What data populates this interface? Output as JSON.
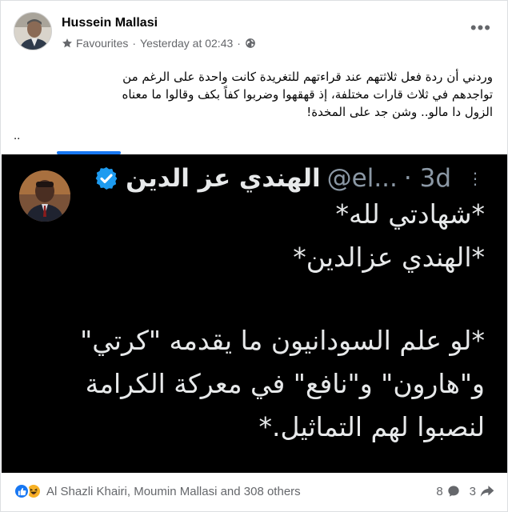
{
  "post": {
    "author": "Hussein Mallasi",
    "audience": "Favourites",
    "separator": "·",
    "timestamp": "Yesterday at 02:43",
    "text_lines": [
      "وردني أن ردة فعل ثلاثتهم عند قراءتهم للتغريدة كانت واحدة على الرغم من",
      "تواجدهم في ثلاث قارات مختلفة، إذ قهقهوا وضربوا كفاً بكف وقالوا ما معناه",
      "الزول دا مالو.. وشن جد على المخدة!"
    ],
    "trailing": ".."
  },
  "tweet": {
    "name": "الهندي عز الدين",
    "handle": "@el...",
    "time": "· 3d",
    "lines": [
      "*شهادتي لله*",
      "*الهندي عزالدين*",
      "*لو علم السودانيون ما يقدمه \"كرتي\"",
      "و\"هارون\" و\"نافع\" في معركة الكرامة",
      "لنصبوا لهم التماثيل.*"
    ]
  },
  "footer": {
    "reactions_text": "Al Shazli Khairi, Moumin Mallasi and 308 others",
    "comments_count": "8",
    "shares_count": "3"
  },
  "colors": {
    "accent": "#1877f2",
    "haha": "#f7b125",
    "muted": "#65676b",
    "tweet_bg": "#000000",
    "tweet_text": "#e7e9ea"
  },
  "icons": {
    "audience": "star-icon",
    "privacy": "globe-icon",
    "menu": "more-horizontal-icon",
    "tweet_menu": "more-vertical-icon",
    "verified": "verified-badge-icon",
    "like": "like-reaction-icon",
    "haha": "haha-reaction-icon",
    "comment": "comment-icon",
    "share": "share-icon"
  }
}
